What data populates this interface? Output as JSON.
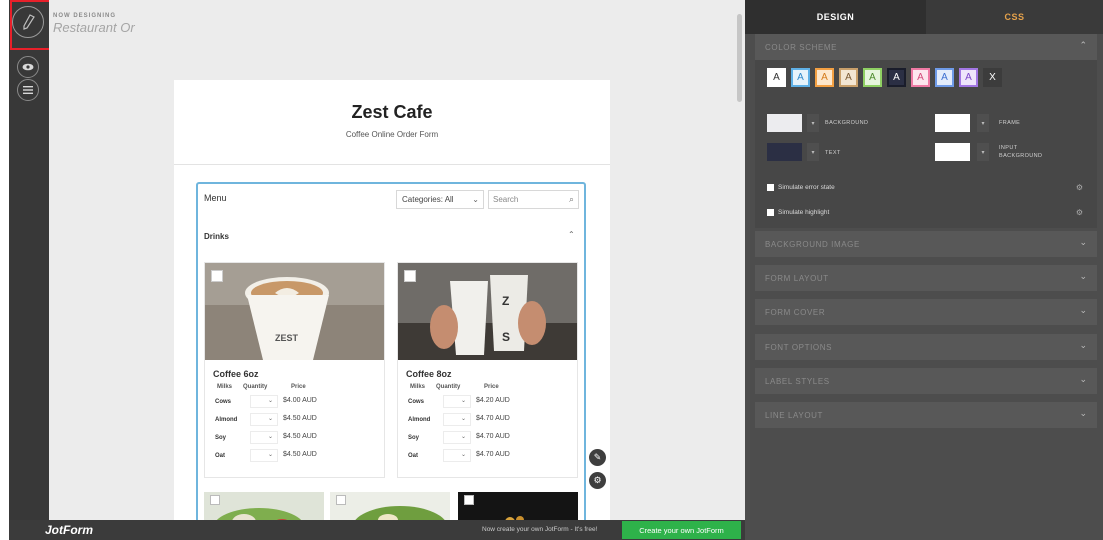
{
  "header": {
    "now_designing": "NOW DESIGNING",
    "form_name": "Restaurant Or"
  },
  "rail": {
    "logo_icon": "pen-nib-icon",
    "preview_icon": "eye-icon",
    "menu_icon": "hamburger-icon"
  },
  "form": {
    "title": "Zest Cafe",
    "subtitle": "Coffee Online Order Form",
    "widget": {
      "menu_label": "Menu",
      "category_select": "Categories: All",
      "search_placeholder": "Search",
      "section": "Drinks",
      "products": [
        {
          "name": "Coffee 6oz",
          "col_milks": "Milks",
          "col_quantity": "Quantity",
          "col_price": "Price",
          "options": [
            {
              "milk": "Cows",
              "price": "$4.00 AUD"
            },
            {
              "milk": "Almond",
              "price": "$4.50 AUD"
            },
            {
              "milk": "Soy",
              "price": "$4.50 AUD"
            },
            {
              "milk": "Oat",
              "price": "$4.50 AUD"
            }
          ]
        },
        {
          "name": "Coffee 8oz",
          "col_milks": "Milks",
          "col_quantity": "Quantity",
          "col_price": "Price",
          "options": [
            {
              "milk": "Cows",
              "price": "$4.20 AUD"
            },
            {
              "milk": "Almond",
              "price": "$4.70 AUD"
            },
            {
              "milk": "Soy",
              "price": "$4.70 AUD"
            },
            {
              "milk": "Oat",
              "price": "$4.70 AUD"
            }
          ]
        }
      ]
    }
  },
  "bottom_bar": {
    "brand": "JotForm",
    "promo": "Now create your own JotForm - It's free!",
    "cta": "Create your own JotForm"
  },
  "panel": {
    "tabs": [
      "DESIGN",
      "CSS"
    ],
    "sections": {
      "color_scheme": "COLOR SCHEME",
      "background_image": "BACKGROUND IMAGE",
      "form_layout": "FORM LAYOUT",
      "form_cover": "FORM COVER",
      "font_options": "FONT OPTIONS",
      "label_styles": "LABEL STYLES",
      "line_layout": "LINE LAYOUT"
    },
    "swatches": [
      {
        "label": "A",
        "bg": "#ffffff",
        "fg": "#333333",
        "border": "#ffffff"
      },
      {
        "label": "A",
        "bg": "#e7f3fb",
        "fg": "#2f87c9",
        "border": "#5fb0e6"
      },
      {
        "label": "A",
        "bg": "#fde7cc",
        "fg": "#d47a1a",
        "border": "#f3a043"
      },
      {
        "label": "A",
        "bg": "#f3e6d3",
        "fg": "#7a5a34",
        "border": "#c9a06b"
      },
      {
        "label": "A",
        "bg": "#e6f5dc",
        "fg": "#4c8a2b",
        "border": "#8fd063"
      },
      {
        "label": "A",
        "bg": "#2b2f44",
        "fg": "#ffffff",
        "border": "#1a1d2b"
      },
      {
        "label": "A",
        "bg": "#fde6ee",
        "fg": "#d2497a",
        "border": "#ef7aa4"
      },
      {
        "label": "A",
        "bg": "#e3ecfb",
        "fg": "#3d6fd1",
        "border": "#6f9be8"
      },
      {
        "label": "A",
        "bg": "#efe5fb",
        "fg": "#7d46c9",
        "border": "#a377e4"
      },
      {
        "label": "X",
        "bg": "#3c3c3c",
        "fg": "#ffffff",
        "border": "#3c3c3c"
      }
    ],
    "colors": {
      "background_label": "BACKGROUND",
      "background_value": "#ececef",
      "frame_label": "FRAME",
      "frame_value": "#ffffff",
      "text_label": "TEXT",
      "text_value": "#2b2f44",
      "input_bg_label_1": "INPUT",
      "input_bg_label_2": "BACKGROUND",
      "input_bg_value": "#ffffff"
    },
    "simulate_error": "Simulate error state",
    "simulate_highlight": "Simulate highlight"
  }
}
